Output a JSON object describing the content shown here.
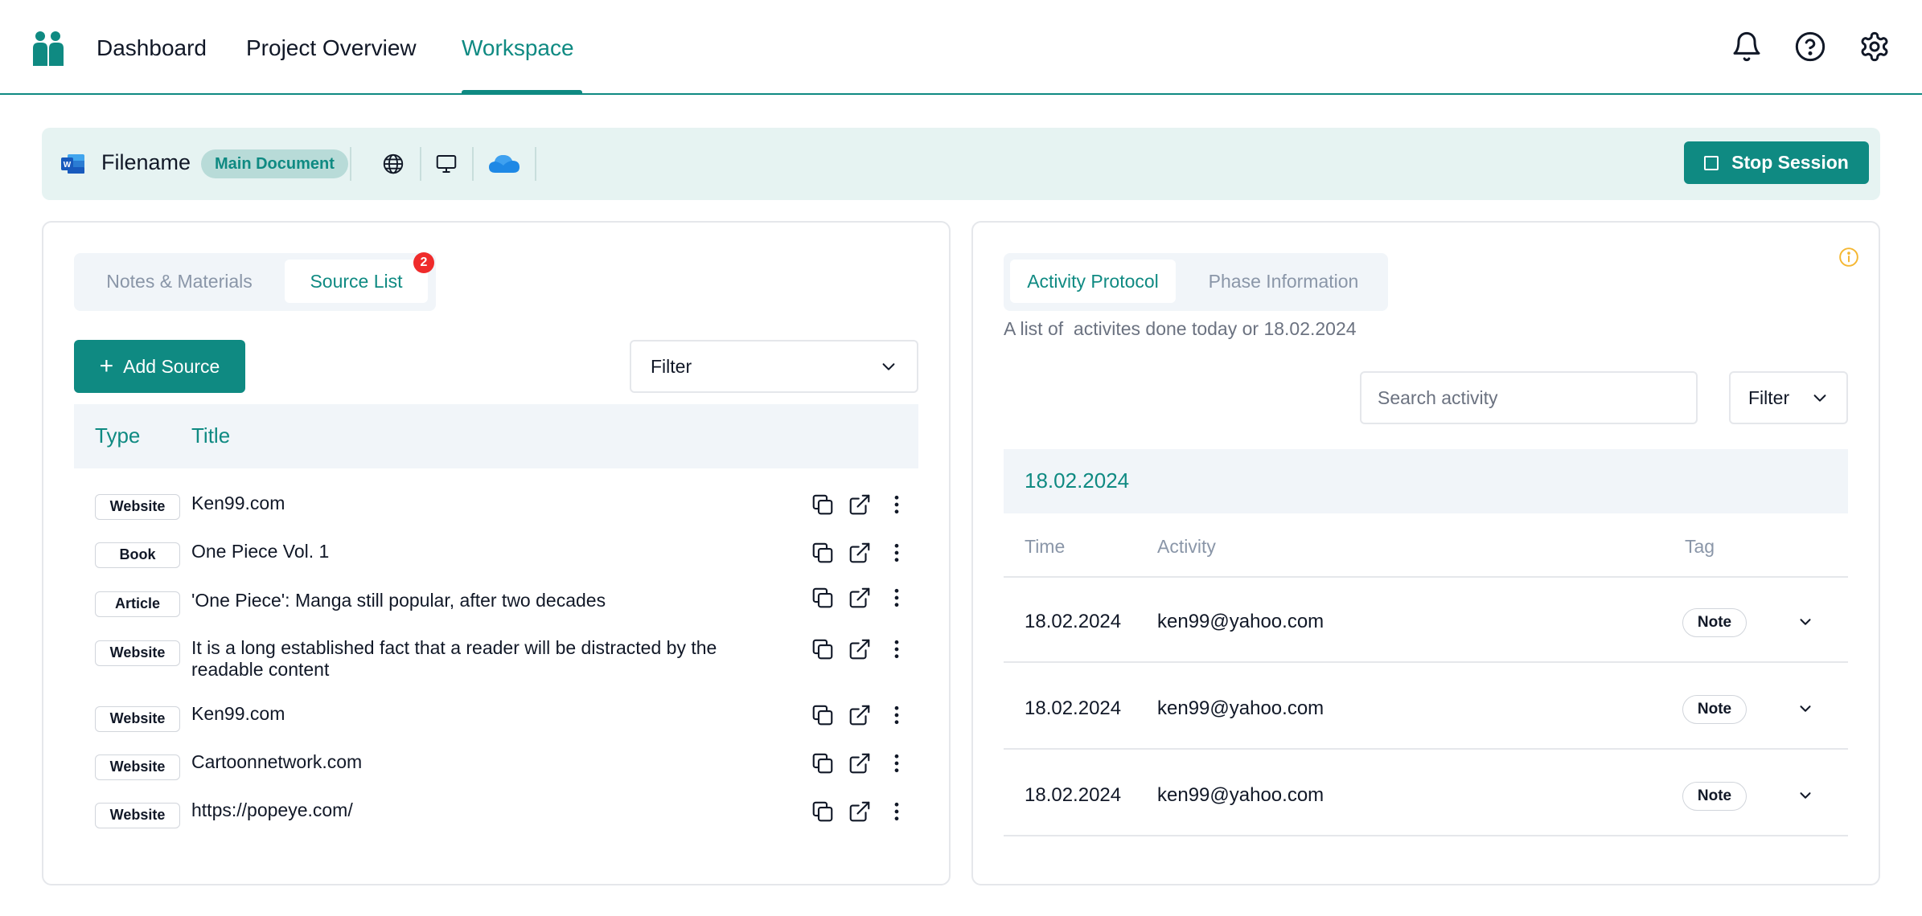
{
  "nav": {
    "items": [
      "Dashboard",
      "Project Overview",
      "Workspace"
    ],
    "active": "Workspace"
  },
  "top_icons": [
    "bell-icon",
    "help-circle-icon",
    "settings-gear-icon"
  ],
  "session": {
    "file_icon": "word-document-icon",
    "filename": "Filename",
    "badge": "Main Document",
    "icons": [
      "globe-icon",
      "monitor-icon",
      "cloud-icon"
    ],
    "stop_label": "Stop Session"
  },
  "left": {
    "tabs": [
      "Notes & Materials",
      "Source List"
    ],
    "active_tab": "Source List",
    "badge_count": "2",
    "add_label": "Add Source",
    "filter_label": "Filter",
    "columns": [
      "Type",
      "Title"
    ],
    "rows": [
      {
        "type": "Website",
        "title": "Ken99.com"
      },
      {
        "type": "Book",
        "title": "One Piece Vol. 1"
      },
      {
        "type": "Article",
        "title": "'One Piece': Manga still popular, after two decades"
      },
      {
        "type": "Website",
        "title": "It is a long established fact that a reader will be distracted by the readable content"
      },
      {
        "type": "Website",
        "title": "Ken99.com"
      },
      {
        "type": "Website",
        "title": "Cartoonnetwork.com"
      },
      {
        "type": "Website",
        "title": "https://popeye.com/"
      }
    ],
    "row_icons": [
      "copy-icon",
      "external-link-icon",
      "more-vertical-icon"
    ]
  },
  "right": {
    "tabs": [
      "Activity Protocol",
      "Phase Information"
    ],
    "active_tab": "Activity Protocol",
    "description": "A list of  activites done today or 18.02.2024",
    "search_placeholder": "Search activity",
    "filter_label": "Filter",
    "date_group": "18.02.2024",
    "columns": [
      "Time",
      "Activity",
      "Tag"
    ],
    "rows": [
      {
        "time": "18.02.2024",
        "activity": "ken99@yahoo.com",
        "tag": "Note"
      },
      {
        "time": "18.02.2024",
        "activity": "ken99@yahoo.com",
        "tag": "Note"
      },
      {
        "time": "18.02.2024",
        "activity": "ken99@yahoo.com",
        "tag": "Note"
      }
    ]
  },
  "colors": {
    "accent": "#0f8a82",
    "accent_light": "#e6f3f2",
    "badge_red": "#ef2b2b",
    "header_bg": "#f1f5f9",
    "info_yellow": "#f5b731"
  }
}
